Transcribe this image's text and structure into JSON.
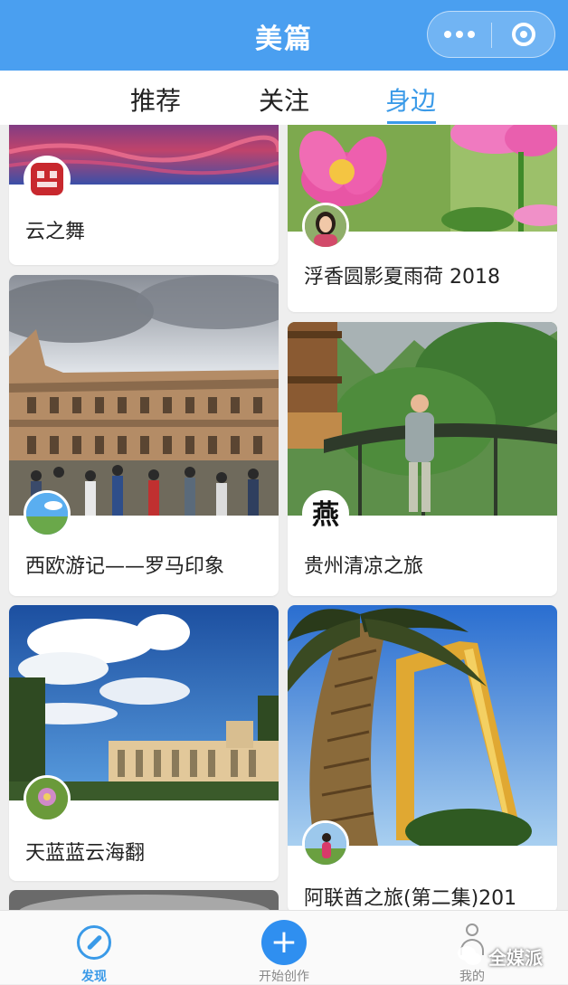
{
  "app": {
    "title": "美篇"
  },
  "tabs": [
    {
      "label": "推荐",
      "active": false
    },
    {
      "label": "关注",
      "active": false
    },
    {
      "label": "身边",
      "active": true
    }
  ],
  "cards": [
    {
      "title": "云之舞",
      "avatar": "seal-avatar",
      "image": "sunset-clouds"
    },
    {
      "title": "浮香圆影夏雨荷 2018",
      "avatar": "woman-avatar",
      "image": "pink-lotus"
    },
    {
      "title": "西欧游记——罗马印象",
      "avatar": "landscape-avatar",
      "image": "colosseum"
    },
    {
      "title": "贵州清凉之旅",
      "avatar": "calligraphy-avatar",
      "avatar_text": "燕",
      "image": "man-in-mountain-garden"
    },
    {
      "title": "天蓝蓝云海翻",
      "avatar": "flower-avatar",
      "image": "blue-sky-buildings"
    },
    {
      "title": "阿联酋之旅(第二集)201",
      "avatar": "woman-field-avatar",
      "image": "palm-tree-dubai-frame"
    }
  ],
  "bottom_nav": [
    {
      "label": "发现",
      "icon": "compass-icon",
      "active": true
    },
    {
      "label": "开始创作",
      "icon": "plus-icon",
      "active": false
    },
    {
      "label": "我的",
      "icon": "person-icon",
      "active": false
    }
  ],
  "watermark": {
    "text": "全媒派"
  },
  "colors": {
    "header": "#4a9ff0",
    "accent": "#3a9ae8",
    "create_button": "#2f8ff0"
  }
}
